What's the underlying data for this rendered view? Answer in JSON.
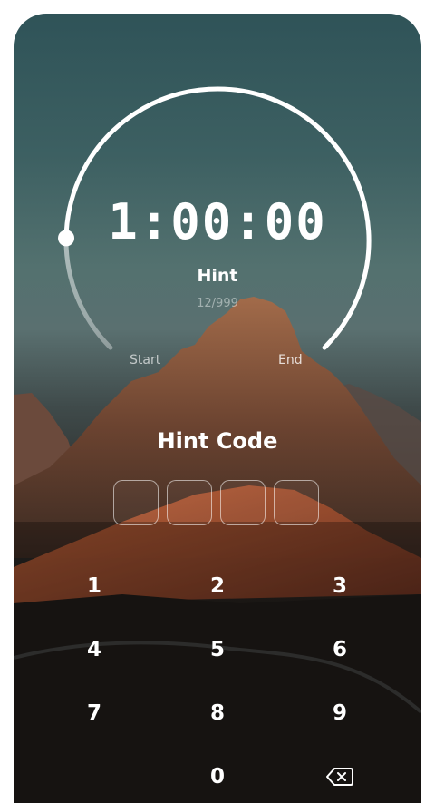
{
  "timer": {
    "time": "1:00:00",
    "hint_label": "Hint",
    "hint_count": "12/999",
    "start_label": "Start",
    "end_label": "End",
    "progress": 0.17
  },
  "hint_code": {
    "title": "Hint Code",
    "digits": [
      "",
      "",
      "",
      ""
    ]
  },
  "keypad": {
    "keys": [
      "1",
      "2",
      "3",
      "4",
      "5",
      "6",
      "7",
      "8",
      "9",
      "0"
    ],
    "backspace_icon": "backspace-icon"
  },
  "colors": {
    "arc": "#ffffff",
    "sky": "#3d6062",
    "rock": "#8a4f33"
  }
}
